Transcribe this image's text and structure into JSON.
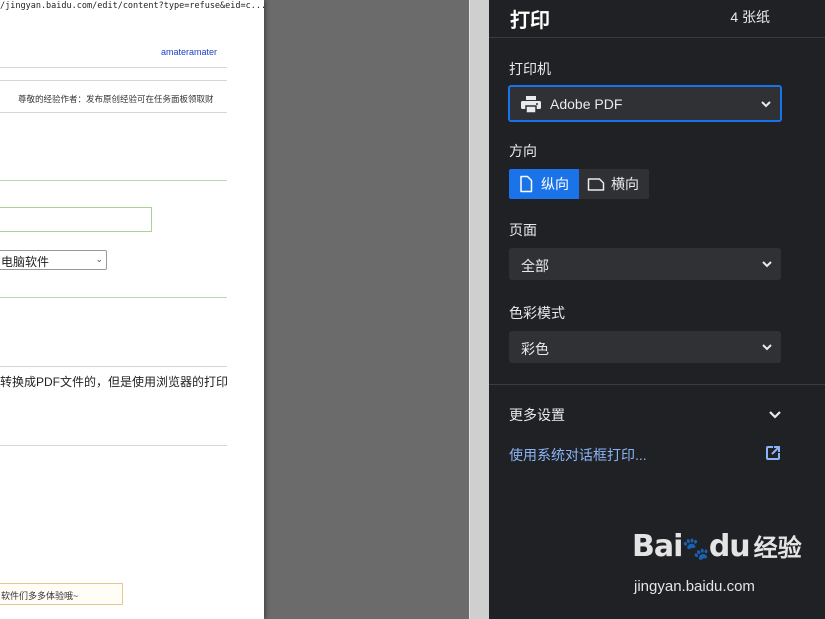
{
  "preview": {
    "url": "/jingyan.baidu.com/edit/content?type=refuse&eid=c...",
    "username": "amateramater",
    "notice": "尊敬的经验作者：发布原创经验可在任务面板领取财",
    "category_select": "电脑软件",
    "body_text": "转换成PDF文件的，但是使用浏览器的打印",
    "tip_text": "软件们多多体验哦~"
  },
  "panel": {
    "title": "打印",
    "sheet_count": "4 张纸",
    "printer_label": "打印机",
    "printer_value": "Adobe PDF",
    "orientation_label": "方向",
    "orientation_portrait": "纵向",
    "orientation_landscape": "横向",
    "orientation_selected": "纵向",
    "pages_label": "页面",
    "pages_value": "全部",
    "color_label": "色彩模式",
    "color_value": "彩色",
    "more_settings": "更多设置",
    "system_dialog": "使用系统对话框打印..."
  },
  "watermark": {
    "brand": "Bai",
    "brand_du": "du",
    "brand_cn": "经验",
    "url": "jingyan.baidu.com"
  },
  "colors": {
    "panel_bg": "#202124",
    "accent": "#1a73e8",
    "link": "#8ab4f8",
    "input_bg": "#303134"
  }
}
